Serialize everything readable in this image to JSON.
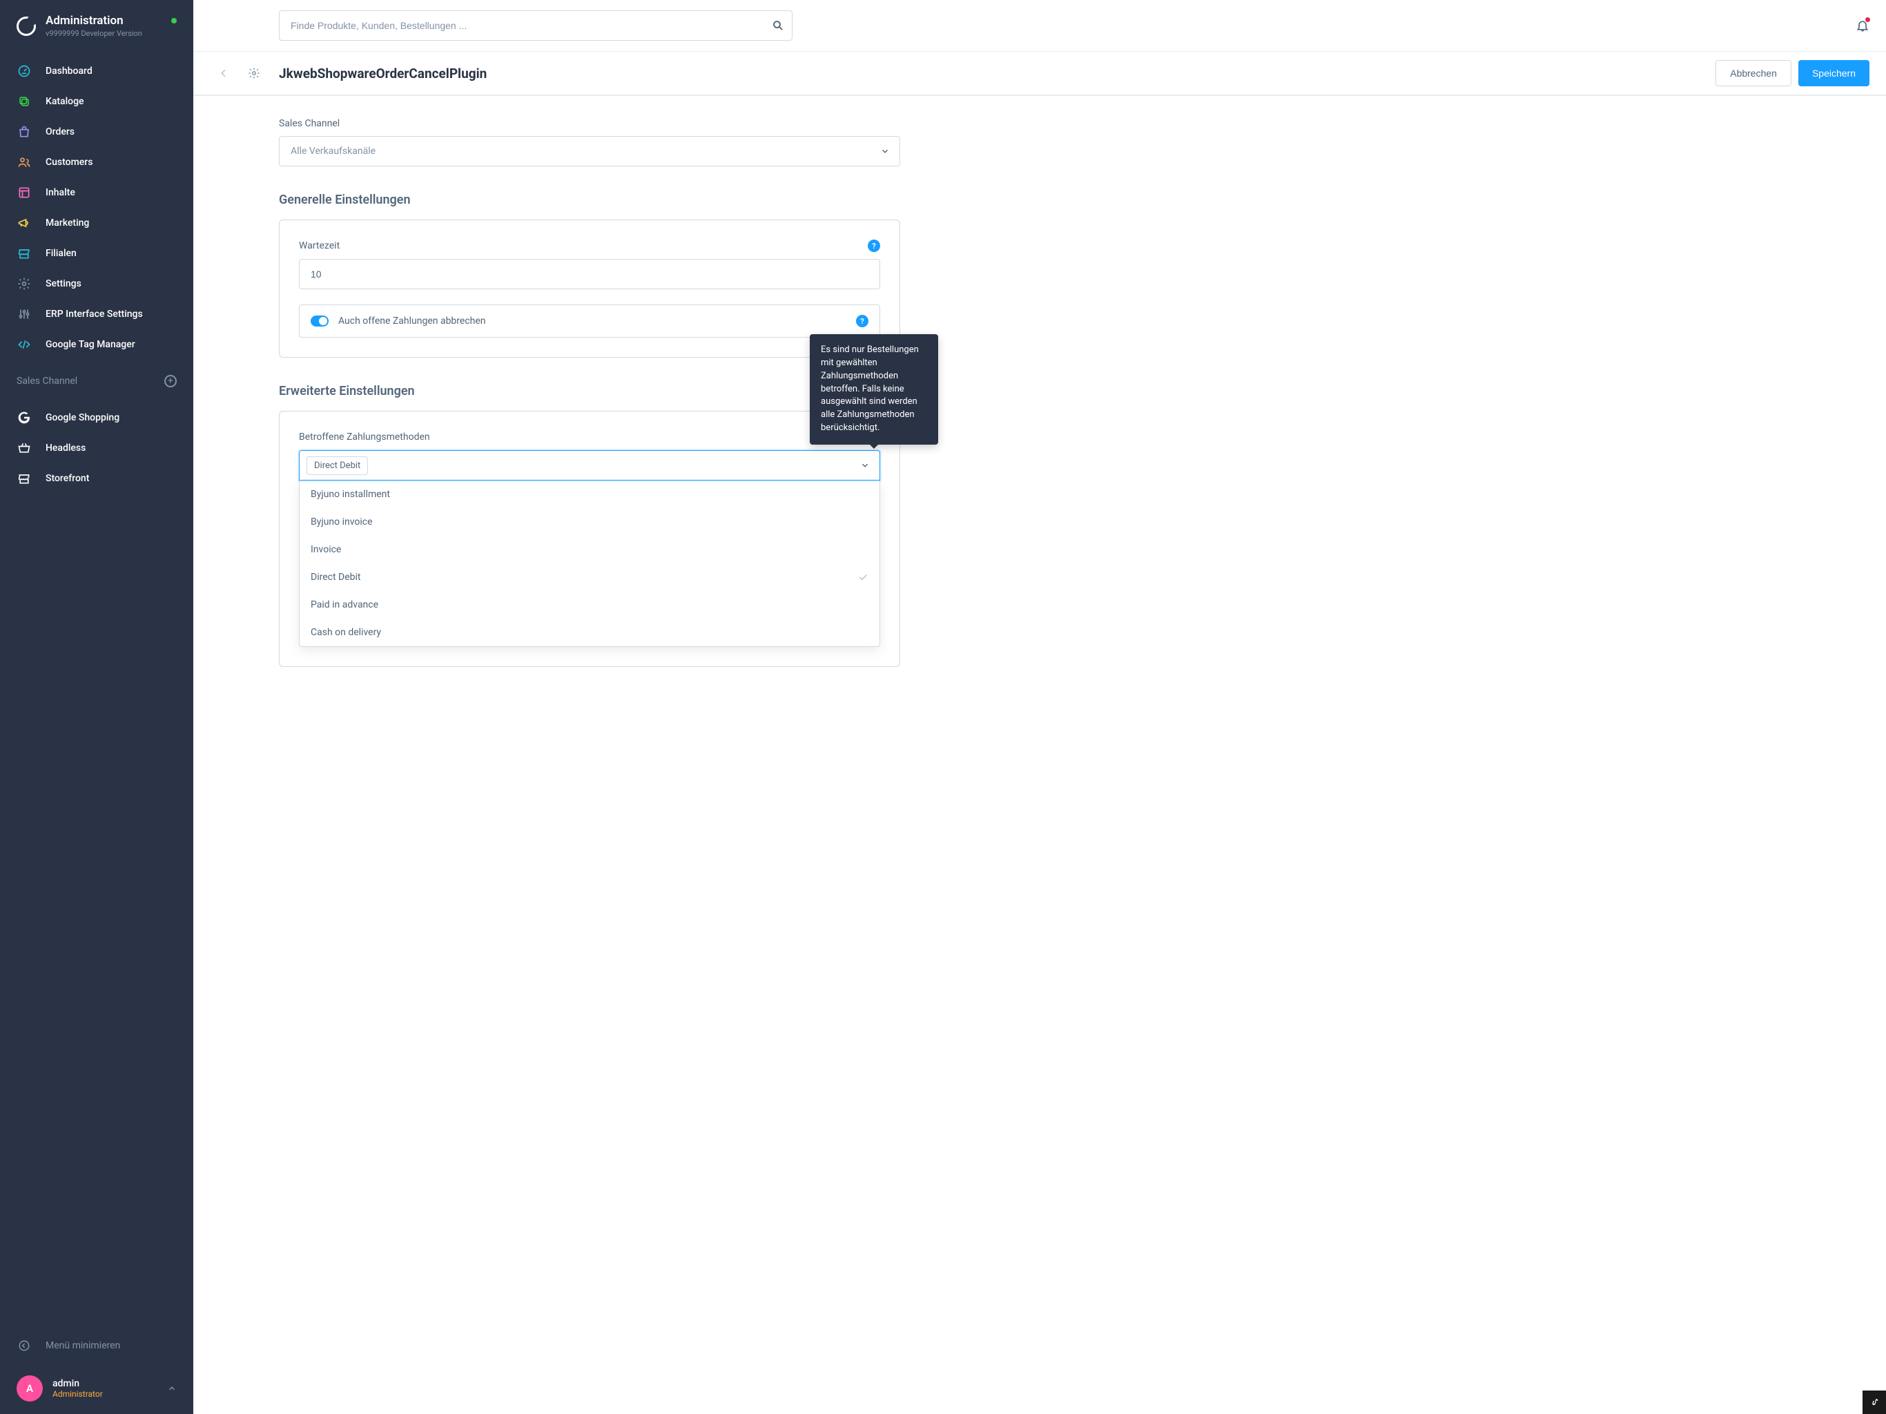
{
  "sidebar": {
    "title": "Administration",
    "version": "v9999999 Developer Version",
    "nav": [
      {
        "label": "Dashboard",
        "icon": "gauge",
        "color": "#29c0d8"
      },
      {
        "label": "Kataloge",
        "icon": "copy",
        "color": "#37d046"
      },
      {
        "label": "Orders",
        "icon": "bag",
        "color": "#a092f0"
      },
      {
        "label": "Customers",
        "icon": "users",
        "color": "#f29d5f"
      },
      {
        "label": "Inhalte",
        "icon": "layout",
        "color": "#ff6ac1"
      },
      {
        "label": "Marketing",
        "icon": "megaphone",
        "color": "#ffd53d"
      },
      {
        "label": "Filialen",
        "icon": "store",
        "color": "#29c0d8"
      },
      {
        "label": "Settings",
        "icon": "gear",
        "color": "#8492a6"
      },
      {
        "label": "ERP Interface Settings",
        "icon": "sliders",
        "color": "#8492a6"
      },
      {
        "label": "Google Tag Manager",
        "icon": "code",
        "color": "#29c0d8"
      }
    ],
    "sales_channel_label": "Sales Channel",
    "channels": [
      {
        "label": "Google Shopping",
        "icon": "google"
      },
      {
        "label": "Headless",
        "icon": "basket"
      },
      {
        "label": "Storefront",
        "icon": "storefront"
      }
    ],
    "minimize": "Menü minimieren",
    "user": {
      "initial": "A",
      "name": "admin",
      "role": "Administrator"
    }
  },
  "topbar": {
    "search_placeholder": "Finde Produkte, Kunden, Bestellungen ..."
  },
  "page": {
    "title": "JkwebShopwareOrderCancelPlugin",
    "cancel": "Abbrechen",
    "save": "Speichern"
  },
  "salesChannel": {
    "label": "Sales Channel",
    "value": "Alle Verkaufskanäle"
  },
  "general": {
    "title": "Generelle Einstellungen",
    "wait_label": "Wartezeit",
    "wait_value": "10",
    "switch_label": "Auch offene Zahlungen abbrechen"
  },
  "advanced": {
    "title": "Erweiterte Einstellungen",
    "payment_label": "Betroffene Zahlungsmethoden",
    "selected_tag": "Direct Debit",
    "options": [
      {
        "label": "Byjuno installment",
        "selected": false
      },
      {
        "label": "Byjuno invoice",
        "selected": false
      },
      {
        "label": "Invoice",
        "selected": false
      },
      {
        "label": "Direct Debit",
        "selected": true
      },
      {
        "label": "Paid in advance",
        "selected": false
      },
      {
        "label": "Cash on delivery",
        "selected": false
      }
    ],
    "tooltip": "Es sind nur Bestellungen mit gewählten Zahlungsmethoden betroffen. Falls keine ausgewählt sind werden alle Zahlungsmethoden berücksichtigt."
  }
}
